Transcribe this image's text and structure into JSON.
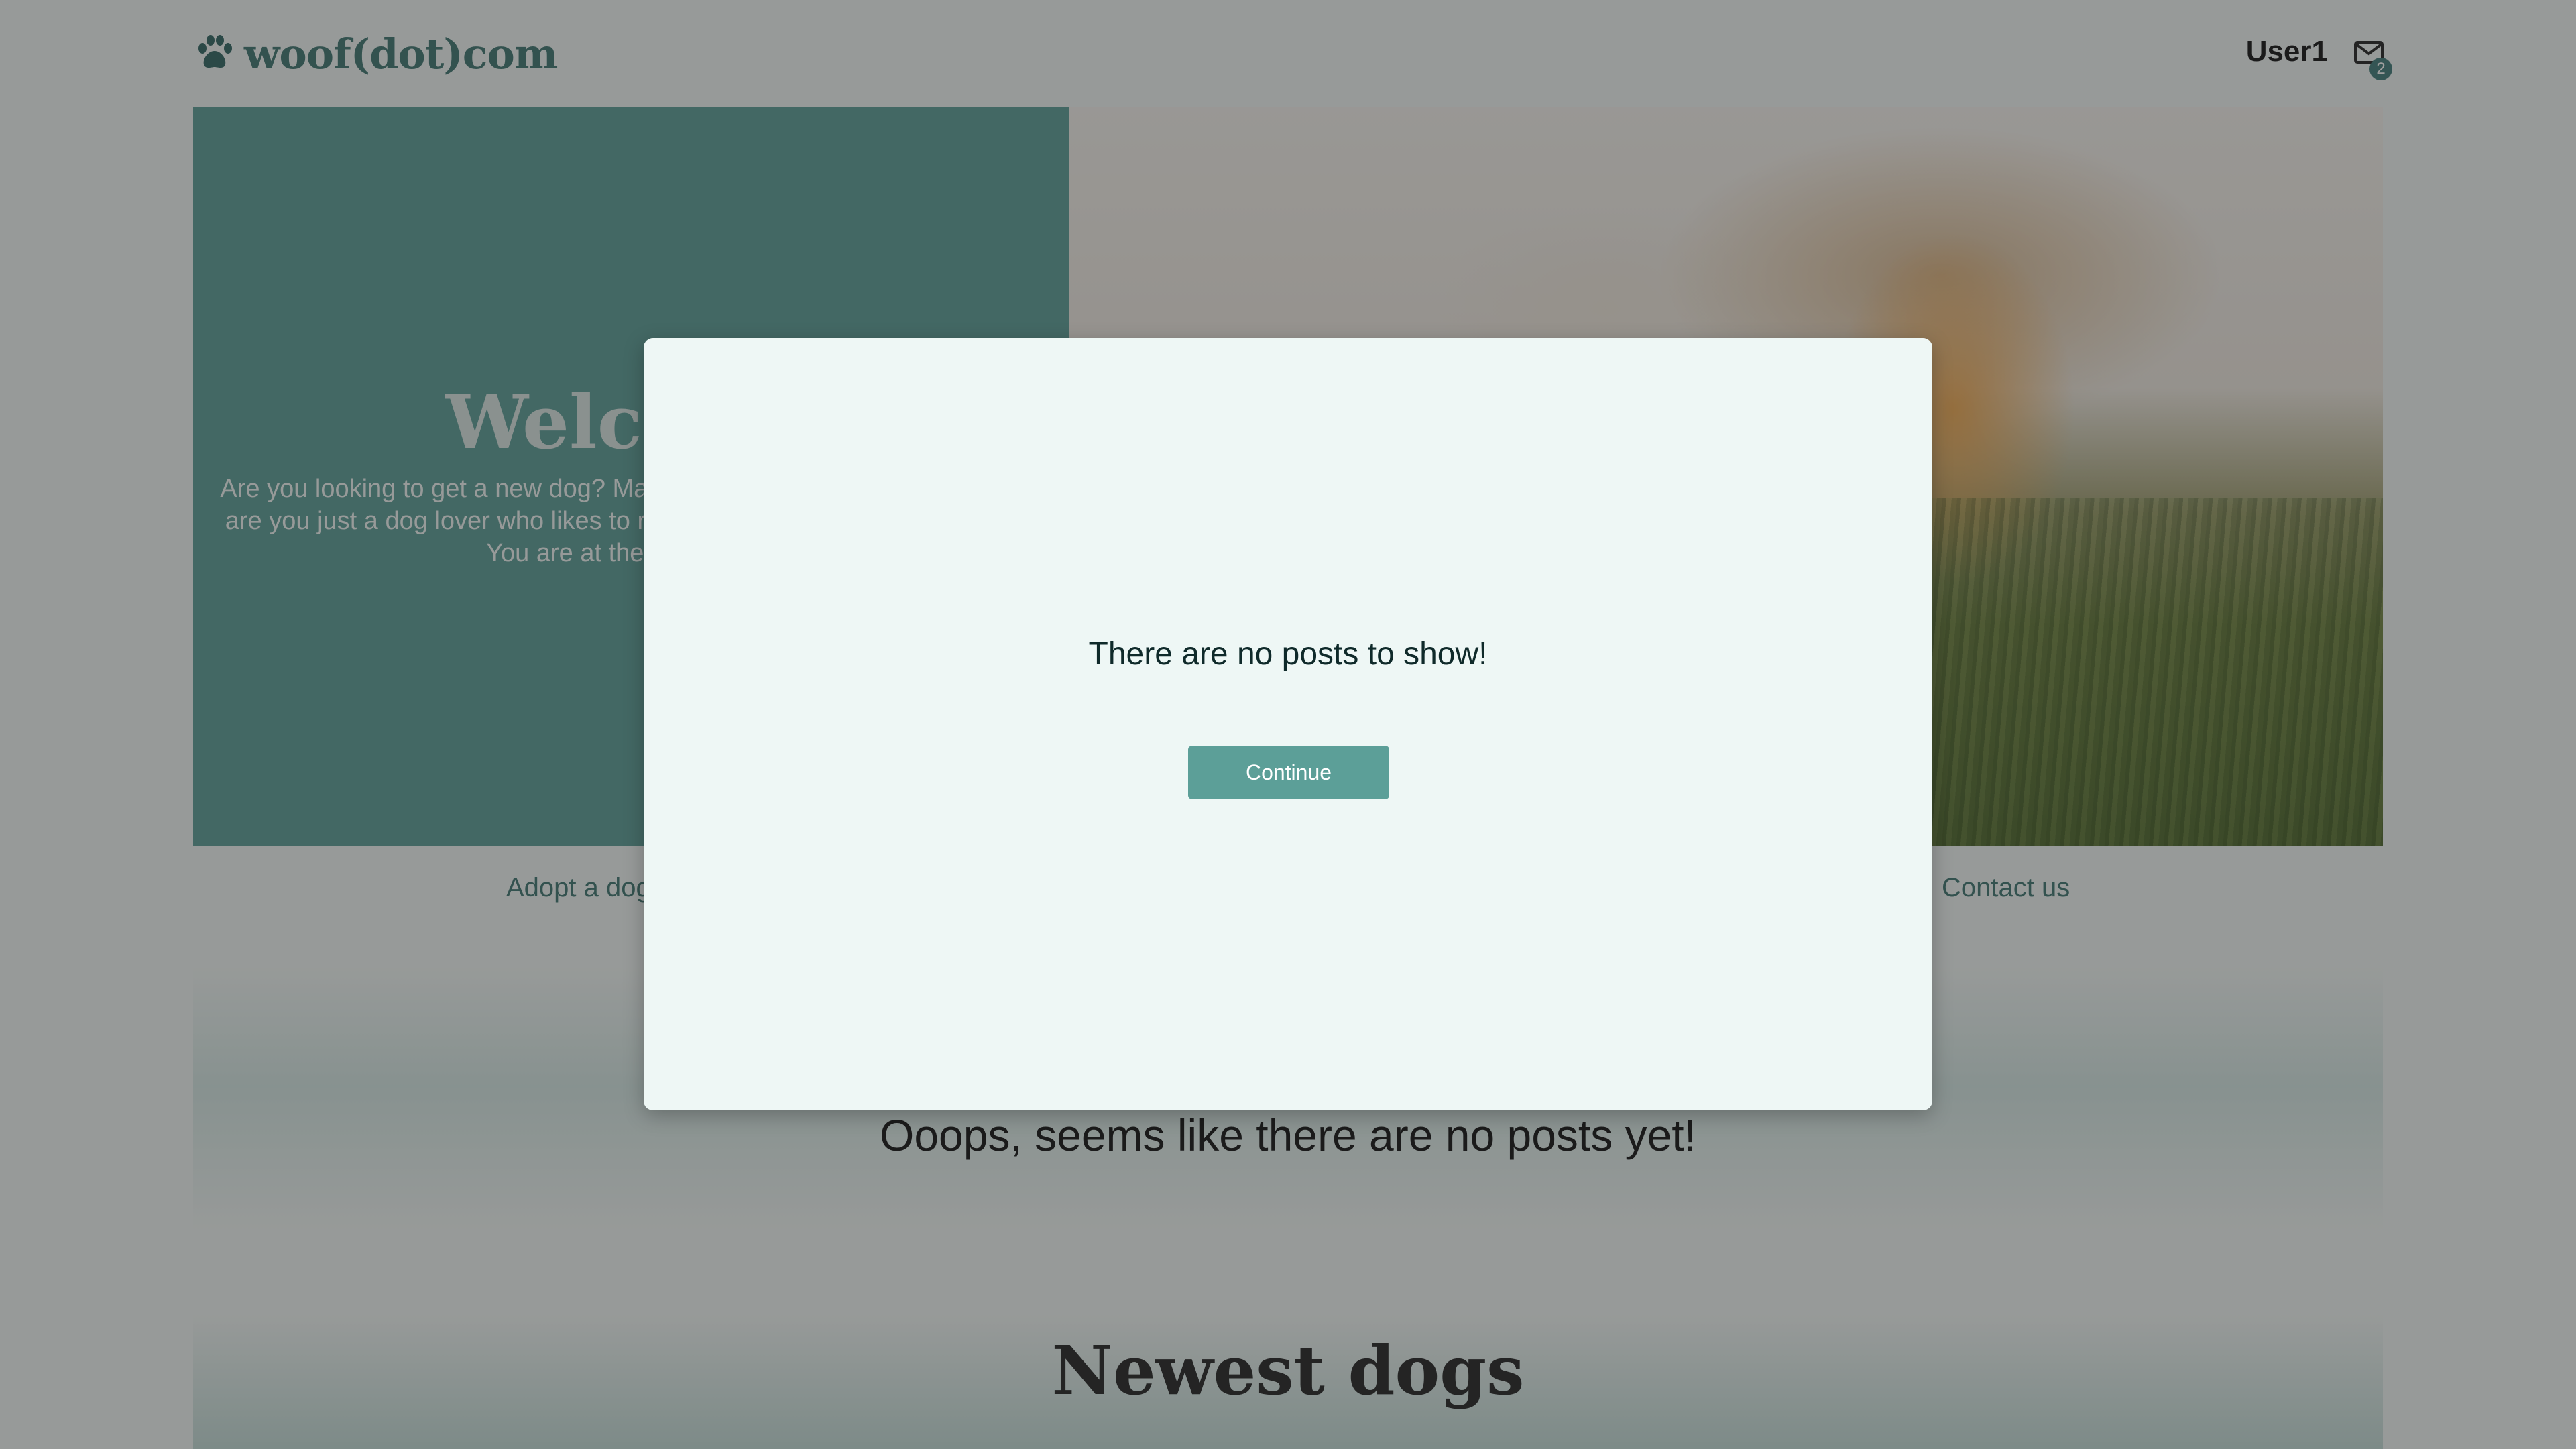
{
  "header": {
    "logo_text": "woof(dot)com",
    "logo_icon": "paw-icon",
    "user_name": "User1",
    "mail_icon": "mail-icon",
    "unread_count": "2"
  },
  "hero": {
    "title": "Welcome",
    "text": "Are you looking to get a new dog? Maybe you have a dog to rehome? Or are you just a dog lover who likes to read about our four-legged friends? You are at the right place!"
  },
  "nav": {
    "adopt": "Adopt a dog",
    "contact": "Contact us"
  },
  "posts": {
    "empty_message": "Ooops, seems like there are no posts yet!"
  },
  "dogs": {
    "heading": "Newest dogs"
  },
  "modal": {
    "message": "There are no posts to show!",
    "continue_label": "Continue"
  },
  "colors": {
    "accent": "#5a9d96",
    "text_accent": "#3d7570",
    "modal_bg": "#eef7f5"
  }
}
